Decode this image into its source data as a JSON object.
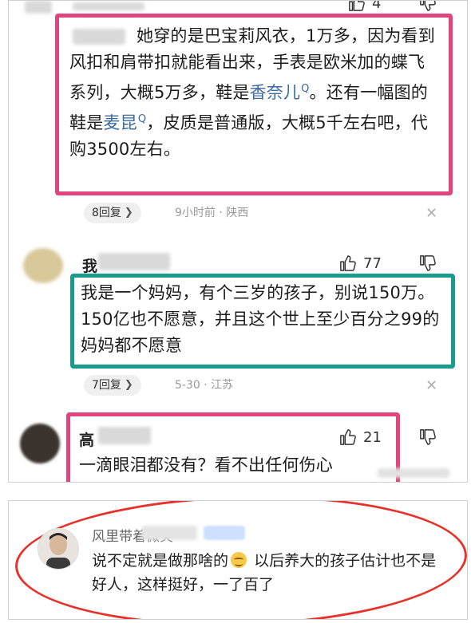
{
  "screenshot_top": {
    "top_partial": {
      "like_count": "4"
    },
    "comment1": {
      "text_part1": "她穿的是巴宝莉风衣，1万多，因为看到风扣和肩带扣就能看出来，手表是欧米加的蝶飞系列，大概5万多，鞋是",
      "link1": "香奈儿",
      "text_part2": "。还有一幅图的鞋是",
      "link2": "麦昆",
      "text_part3": "，皮质是普通版，大概5千左右吧，代购3500左右。",
      "reply_label": "8回复",
      "meta": "9小时前 · 陕西"
    },
    "comment2": {
      "username": "我",
      "like_count": "77",
      "text": "我是一个妈妈，有个三岁的孩子，别说150万。150亿也不愿意，并且这个世上至少百分之99的妈妈都不愿意",
      "reply_label": "7回复",
      "meta": "5-30 · 江苏"
    },
    "comment3": {
      "username": "高",
      "like_count": "21",
      "text": "一滴眼泪都没有？看不出任何伤心"
    }
  },
  "screenshot_bottom": {
    "comment": {
      "username": "风里带着微笑",
      "text_part1": "说不定就是做那啥的",
      "text_part2": "以后养大的孩子估计也不是好人，这样挺好，一了百了"
    }
  },
  "icons": {
    "thumb_up": "thumb-up-icon",
    "thumb_down": "thumb-down-icon",
    "search": "search-icon",
    "close": "close-icon",
    "chevron": "chevron-right-icon",
    "emoji": "smile-emoji-icon"
  },
  "colors": {
    "pink_box": "#e0457e",
    "teal_box": "#1b9a8e",
    "red_oval": "#e6322a",
    "link": "#3b6aa0"
  }
}
